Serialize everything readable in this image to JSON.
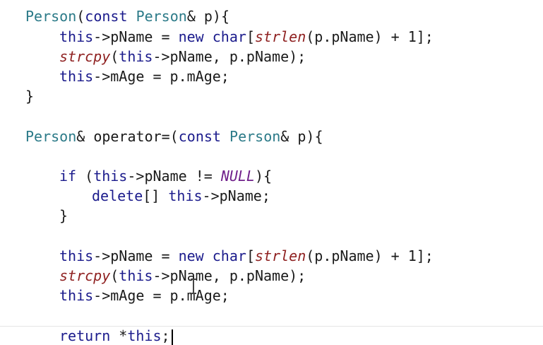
{
  "code": {
    "l1": {
      "a": "Person",
      "b": "(",
      "c": "const",
      "d": " ",
      "e": "Person",
      "f": "& p){"
    },
    "l2": {
      "a": "this",
      "b": "->pName = ",
      "c": "new",
      "d": " ",
      "e": "char",
      "f": "[",
      "g": "strlen",
      "h": "(p.pName) + 1];"
    },
    "l3": {
      "a": "strcpy",
      "b": "(",
      "c": "this",
      "d": "->pName, p.pName);"
    },
    "l4": {
      "a": "this",
      "b": "->mAge = p.mAge;"
    },
    "l5": {
      "a": "}"
    },
    "l6": {
      "a": "Person",
      "b": "& ",
      "c": "operator",
      "d": "=(",
      "e": "const",
      "f": " ",
      "g": "Person",
      "h": "& p){"
    },
    "l7": {
      "a": "if",
      "b": " (",
      "c": "this",
      "d": "->pName != ",
      "e": "NULL",
      "f": "){"
    },
    "l8": {
      "a": "delete",
      "b": "[] ",
      "c": "this",
      "d": "->pName;"
    },
    "l9": {
      "a": "}"
    },
    "l10": {
      "a": "this",
      "b": "->pName = ",
      "c": "new",
      "d": " ",
      "e": "char",
      "f": "[",
      "g": "strlen",
      "h": "(p.pName) + 1];"
    },
    "l11": {
      "a": "strcpy",
      "b": "(",
      "c": "this",
      "d": "->pName, p.pName);"
    },
    "l12": {
      "a": "this",
      "b": "->mAge = p.mAge;"
    },
    "l13": {
      "a": "return",
      "b": " *",
      "c": "this",
      "d": ";"
    }
  },
  "colors": {
    "keyword": "#1b1b8c",
    "type": "#2b7a88",
    "function": "#8e1f1f",
    "macro": "#6f1f8a",
    "text": "#1a1a1a",
    "background": "#ffffff"
  },
  "icons": {
    "mouse_cursor": "i-beam-cursor-icon",
    "text_caret": "text-caret-icon"
  }
}
